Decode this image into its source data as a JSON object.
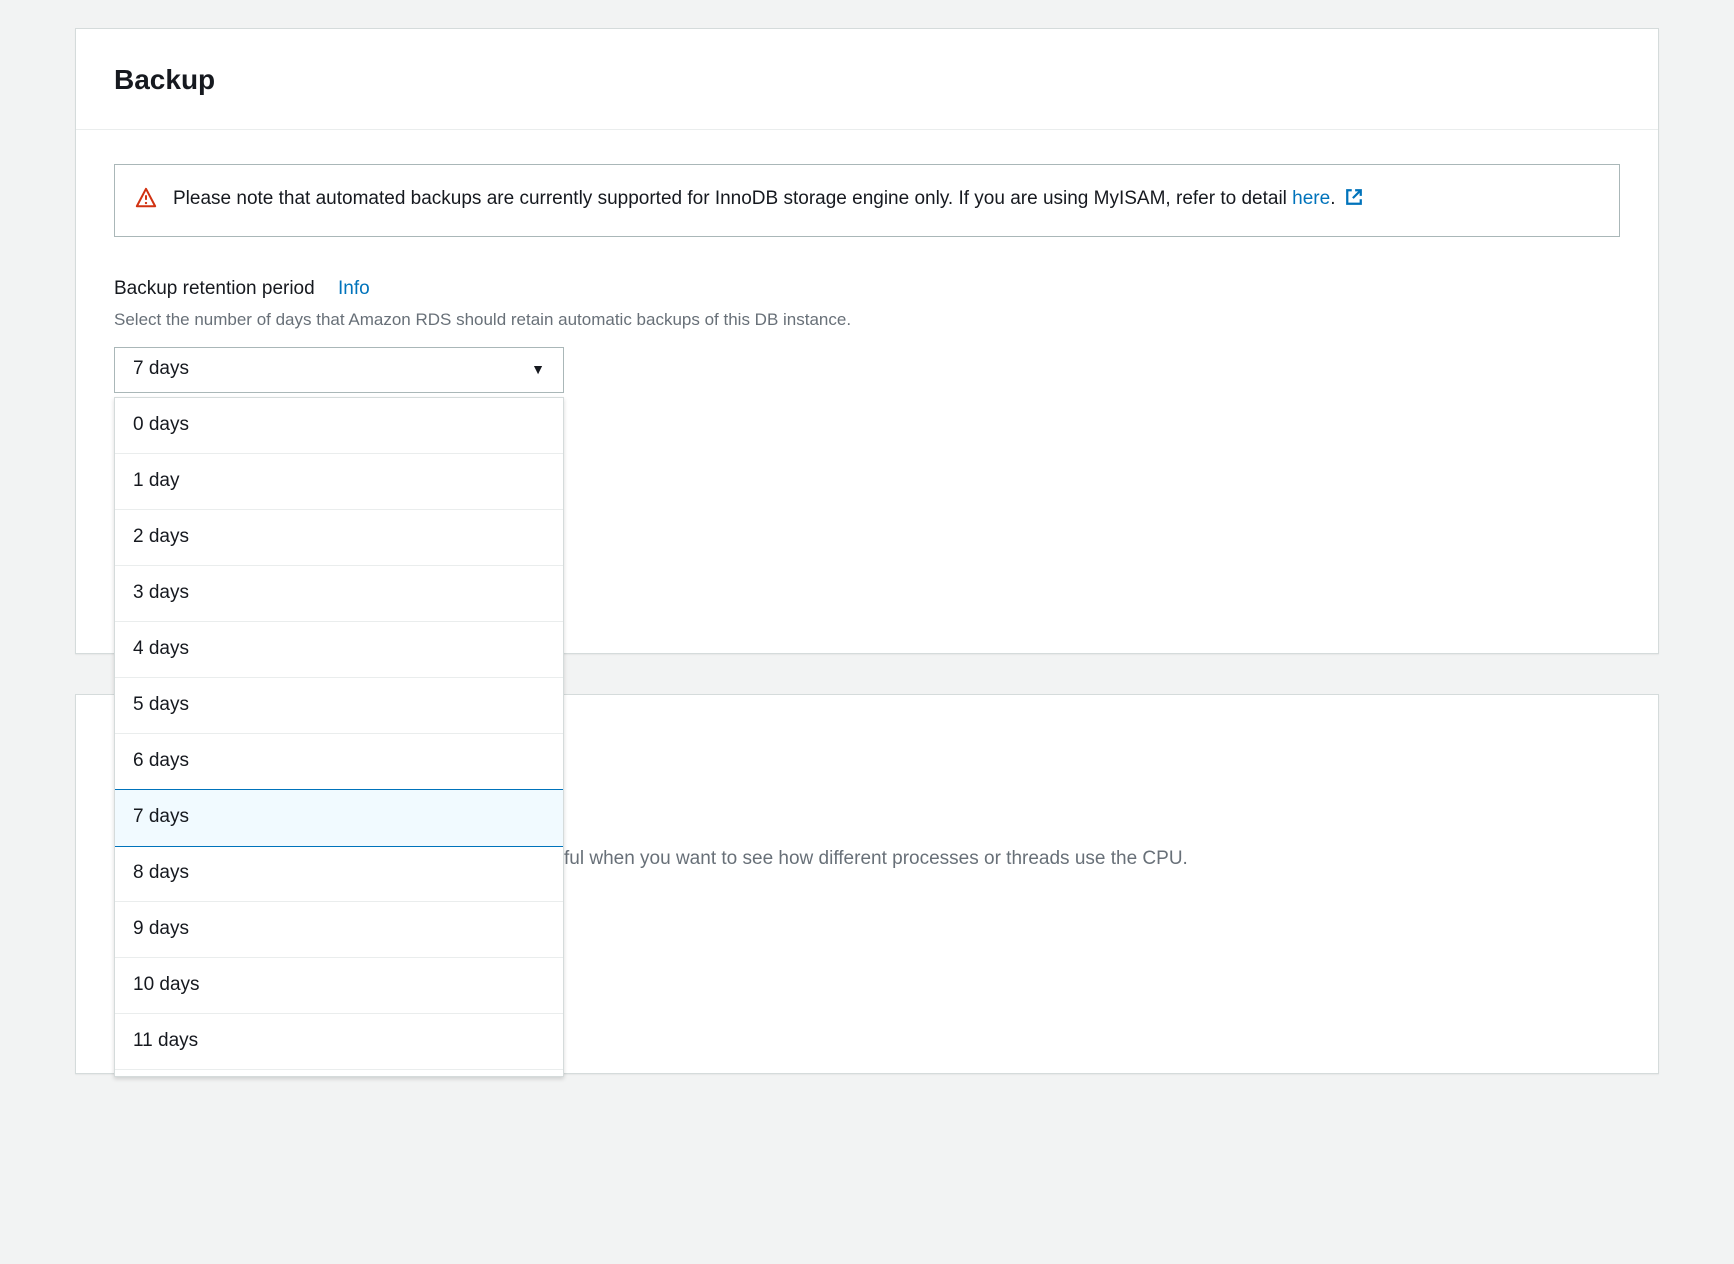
{
  "panel": {
    "title": "Backup",
    "alert": {
      "text_before": "Please note that automated backups are currently supported for InnoDB storage engine only. If you are using MyISAM, refer to detail ",
      "link_text": "here",
      "text_after": "."
    },
    "retention": {
      "label": "Backup retention period",
      "info_label": "Info",
      "help": "Select the number of days that Amazon RDS should retain automatic backups of this DB instance.",
      "selected_value": "7 days",
      "selected_index": 7,
      "options": [
        "0 days",
        "1 day",
        "2 days",
        "3 days",
        "4 days",
        "5 days",
        "6 days",
        "7 days",
        "8 days",
        "9 days",
        "10 days",
        "11 days"
      ]
    }
  },
  "secondary": {
    "partial_text": "ful when you want to see how different processes or threads use the CPU."
  }
}
